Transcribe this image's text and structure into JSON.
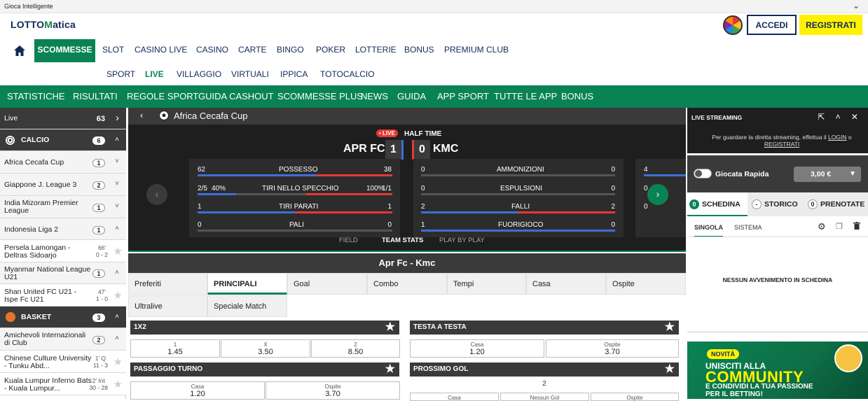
{
  "topstrip": {
    "text": "Gioca Intelligente",
    "chevron": "⌄"
  },
  "header": {
    "logo_pre": "LOTTO",
    "logo_mid": "M",
    "logo_post": "atica",
    "login_label": "ACCEDI",
    "register_label": "REGISTRATI"
  },
  "nav1": [
    "SCOMMESSE",
    "SLOT",
    "CASINO LIVE",
    "CASINO",
    "CARTE",
    "BINGO",
    "POKER",
    "LOTTERIE",
    "BONUS",
    "PREMIUM CLUB"
  ],
  "nav2": [
    "SPORT",
    "LIVE",
    "VILLAGGIO",
    "VIRTUALI",
    "IPPICA",
    "TOTOCALCIO"
  ],
  "greenbar": [
    "STATISTICHE",
    "RISULTATI",
    "REGOLE SPORT",
    "GUIDA CASHOUT",
    "SCOMMESSE PLUS",
    "NEWS",
    "GUIDA",
    "APP SPORT",
    "TUTTE LE APP",
    "BONUS"
  ],
  "sidebar": {
    "live_label": "Live",
    "live_count": "63",
    "calcio_label": "CALCIO",
    "calcio_count": "6",
    "basket_label": "BASKET",
    "basket_count": "3",
    "leagues": [
      {
        "name": "Africa Cecafa Cup",
        "count": "1"
      },
      {
        "name": "Giappone J. League 3",
        "count": "2"
      },
      {
        "name": "India Mizoram Premier League",
        "count": "1"
      },
      {
        "name": "Indonesia Liga 2",
        "count": "1"
      },
      {
        "name": "Myanmar National League U21",
        "count": "1"
      },
      {
        "name": "Amichevoli Internazionali di Club",
        "count": "2"
      }
    ],
    "events": [
      {
        "name": "Persela Lamongan - Deltras Sidoarjo",
        "time": "66'",
        "score": "0 - 2"
      },
      {
        "name": "Shan United FC U21 - Ispe Fc U21",
        "time": "47'",
        "score": "1 - 0"
      },
      {
        "name": "Chinese Culture University - Tunku Abd...",
        "time": "1' Q",
        "score": "11 - 3"
      },
      {
        "name": "Kuala Lumpur Inferno Bats - Kuala Lumpur...",
        "time": "2' Int",
        "score": "30 - 28"
      }
    ]
  },
  "event_header": {
    "back": "‹",
    "competition": "Africa Cecafa Cup"
  },
  "scoreboard": {
    "live_badge": "• LIVE",
    "status": "HALF TIME",
    "home": "APR FC",
    "away": "KMC",
    "home_score": "1",
    "away_score": "0",
    "stats_left": [
      {
        "h": "62",
        "label": "POSSESSO",
        "a": "38"
      },
      {
        "h": "2/5",
        "hp": "40%",
        "label": "TIRI NELLO SPECCHIO",
        "ap": "100%",
        "a": "1/1"
      },
      {
        "h": "1",
        "label": "TIRI PARATI",
        "a": "1"
      },
      {
        "h": "0",
        "label": "PALI",
        "a": "0"
      }
    ],
    "stats_right": [
      {
        "h": "0",
        "label": "AMMONIZIONI",
        "a": "0"
      },
      {
        "h": "0",
        "label": "ESPULSIONI",
        "a": "0"
      },
      {
        "h": "2",
        "label": "FALLI",
        "a": "2"
      },
      {
        "h": "1",
        "label": "FUORIGIOCO",
        "a": "0"
      }
    ],
    "stats_extra": [
      "4",
      "0",
      "0"
    ],
    "prev": "‹",
    "next": "›",
    "tabs": [
      "FIELD",
      "TEAM STATS",
      "PLAY BY PLAY"
    ]
  },
  "match_title": "Apr Fc - Kmc",
  "market_tabs": [
    "Preferiti",
    "PRINCIPALI",
    "Goal",
    "Combo",
    "Tempi",
    "Casa",
    "Ospite",
    "Ultralive",
    "Speciale Match"
  ],
  "markets": {
    "m1x2": {
      "title": "1X2",
      "odds": [
        {
          "l": "1",
          "v": "1.45"
        },
        {
          "l": "X",
          "v": "3.50"
        },
        {
          "l": "2",
          "v": "8.50"
        }
      ]
    },
    "testa": {
      "title": "TESTA A TESTA",
      "odds": [
        {
          "l": "Casa",
          "v": "1.20"
        },
        {
          "l": "Ospite",
          "v": "3.70"
        }
      ]
    },
    "passaggio": {
      "title": "PASSAGGIO TURNO",
      "odds": [
        {
          "l": "Casa",
          "v": "1.20"
        },
        {
          "l": "Ospite",
          "v": "3.70"
        }
      ]
    },
    "prossimo": {
      "title": "PROSSIMO GOL",
      "line": "2",
      "labels": [
        "Casa",
        "Nessun Gol",
        "Ospite"
      ]
    }
  },
  "right": {
    "stream_title": "LIVE STREAMING",
    "stream_icons": "⇱ ˄ ✕",
    "stream_msg_1": "Per guardare la diretta streaming, effettua il ",
    "stream_login": "LOGIN",
    "stream_msg_2": " o ",
    "stream_register": "REGISTRATI",
    "rapida_label": "Giocata Rapida",
    "rapida_value": "3,00 €",
    "bet_tabs": [
      {
        "n": "0",
        "l": "SCHEDINA"
      },
      {
        "n": "-",
        "l": "STORICO"
      },
      {
        "n": "0",
        "l": "PRENOTATE"
      }
    ],
    "sub_tabs": [
      "SINGOLA",
      "SISTEMA"
    ],
    "empty_msg": "NESSUN AVVENIMENTO IN SCHEDINA",
    "promo_badge": "NOVITÀ",
    "promo_l1": "UNISCITI ALLA",
    "promo_l2": "COMMUNITY",
    "promo_l3": "E CONDIVIDI LA TUA PASSIONE",
    "promo_l4": "PER IL BETTING!"
  },
  "colors": {
    "brand_green": "#0a8354",
    "brand_navy": "#0f2a5a",
    "accent_yellow": "#fff200",
    "home_bar": "#3f6fd6",
    "away_bar": "#e53935"
  }
}
